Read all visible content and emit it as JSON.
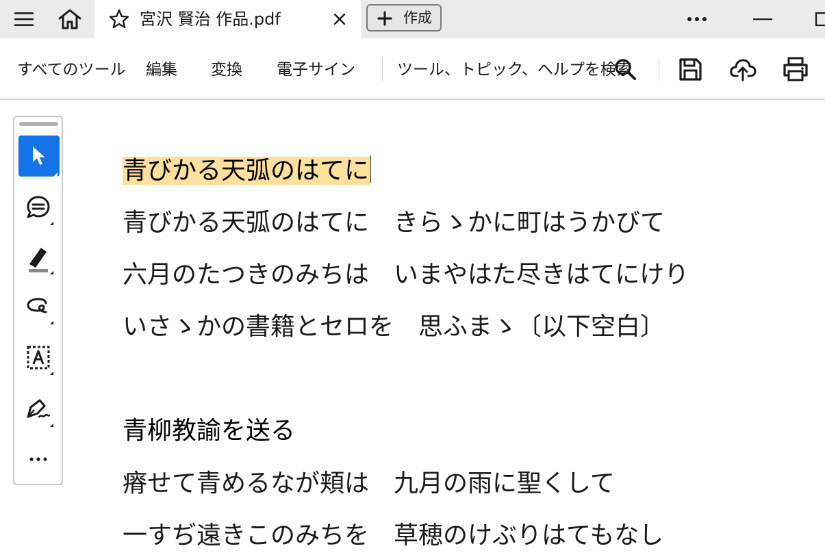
{
  "titlebar": {
    "menu_icon": "hamburger-menu-icon",
    "home_icon": "home-icon",
    "tab": {
      "title": "宮沢 賢治 作品.pdf",
      "star_icon": "star-icon",
      "close_icon": "close-icon"
    },
    "create_button": {
      "label": "作成",
      "icon": "plus-icon"
    },
    "more_icon": "more-horizontal-icon",
    "minimize_icon": "minimize-icon",
    "maximize_icon": "maximize-icon"
  },
  "toolbar": {
    "links": [
      "すべてのツール",
      "編集",
      "変換",
      "電子サイン"
    ],
    "search_label": "ツール、トピック、ヘルプを検索",
    "search_icon": "search-icon",
    "save_icon": "save-icon",
    "upload_icon": "cloud-upload-icon",
    "print_icon": "print-icon"
  },
  "side_tools": [
    {
      "name": "select-tool",
      "icon": "cursor-icon",
      "active": true
    },
    {
      "name": "comment-tool",
      "icon": "comment-icon",
      "active": false
    },
    {
      "name": "highlight-tool",
      "icon": "highlighter-icon",
      "active": false
    },
    {
      "name": "draw-tool",
      "icon": "freehand-draw-icon",
      "active": false
    },
    {
      "name": "text-box-tool",
      "icon": "text-box-icon",
      "active": false
    },
    {
      "name": "sign-tool",
      "icon": "signature-pen-icon",
      "active": false
    },
    {
      "name": "more-tools",
      "icon": "more-horizontal-icon",
      "active": false
    }
  ],
  "document": {
    "highlighted_title": "青びかる天弧のはてに",
    "lines": [
      "青びかる天弧のはてに　きらゝかに町はうかびて",
      "六月のたつきのみちは　いまやはた尽きはてにけり",
      "いさゝかの書籍とセロを　思ふまゝ〔以下空白〕"
    ],
    "heading2": "青柳教諭を送る",
    "lines2": [
      "瘠せて青めるなが頬は　九月の雨に聖くして",
      "一すぢ遠きこのみちを　草穂のけぶりはてもなし"
    ],
    "colors": {
      "highlight": "#fbe19b",
      "accent": "#1473e6"
    }
  }
}
